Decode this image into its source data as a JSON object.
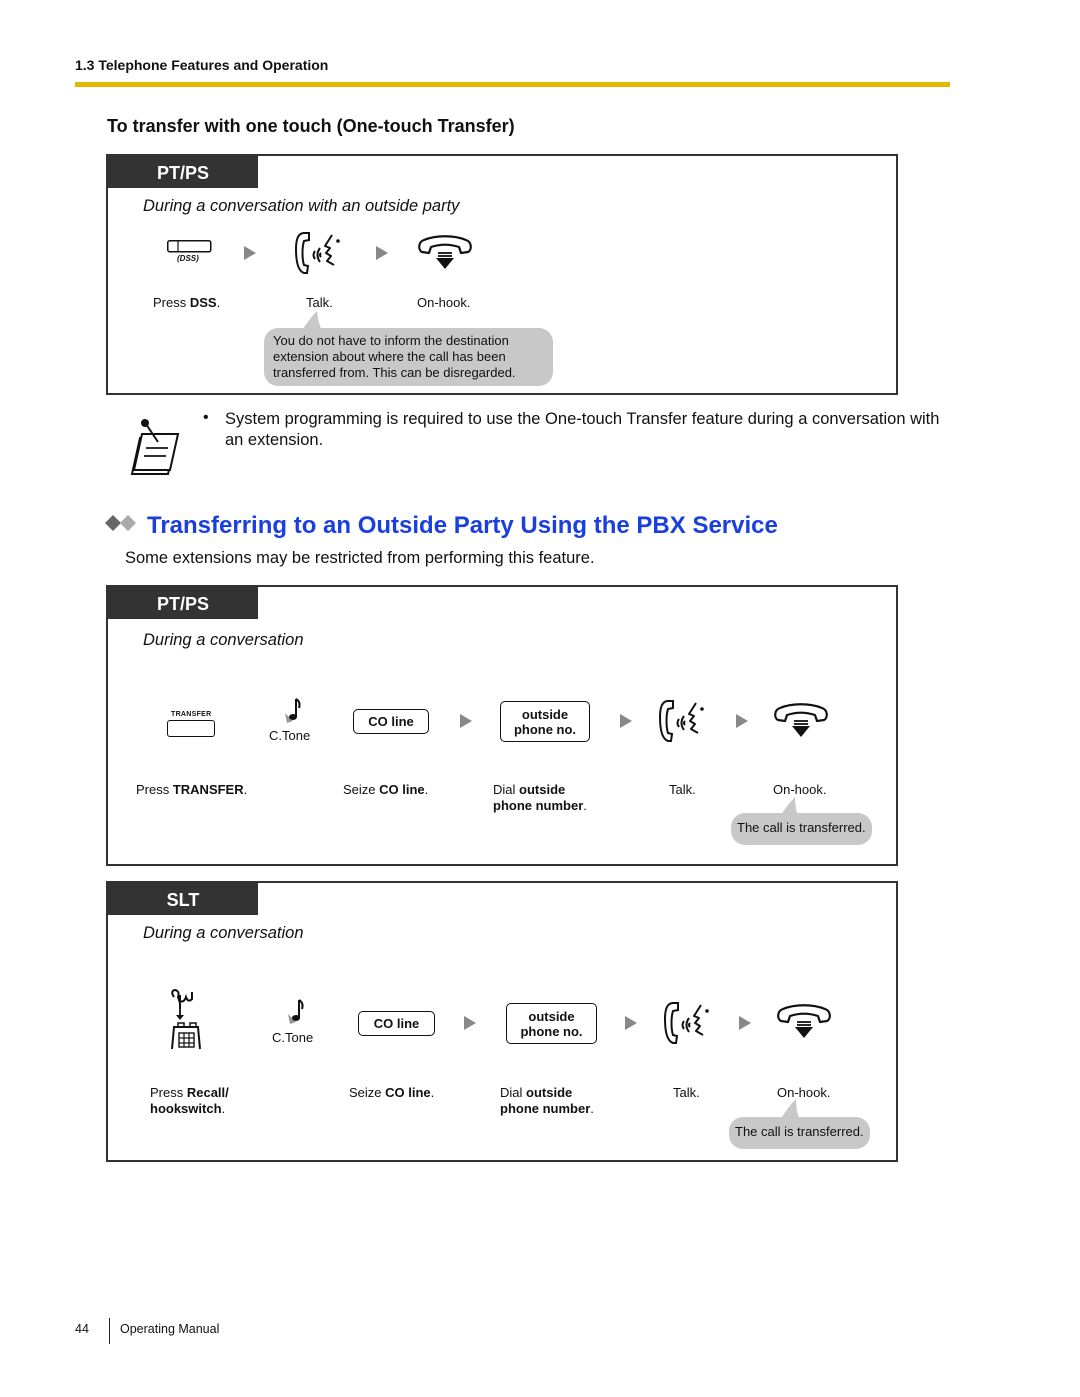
{
  "header": {
    "running_head": "1.3 Telephone Features and Operation",
    "accent_color": "#e3b800"
  },
  "one_touch": {
    "subheading": "To transfer with one touch (One-touch Transfer)",
    "box": {
      "tag": "PT/PS",
      "situation": "During a conversation with an outside party",
      "dss_key_label": "(DSS)",
      "steps": [
        {
          "prefix": "Press ",
          "bold": "DSS",
          "suffix": "."
        },
        {
          "prefix": "Talk.",
          "bold": "",
          "suffix": ""
        },
        {
          "prefix": "On-hook.",
          "bold": "",
          "suffix": ""
        }
      ],
      "bubble": "You do not have to inform the destination extension about where the call has been transferred from. This can be disregarded."
    },
    "note": "System programming is required to use the One-touch Transfer feature during a conversation with an extension.",
    "note_bullet": "•"
  },
  "pbx_section": {
    "title": "Transferring to an Outside Party Using the PBX Service",
    "title_color": "#1a3fe0",
    "intro": "Some extensions may be restricted from performing this feature.",
    "pt_box": {
      "tag": "PT/PS",
      "situation": "During a conversation",
      "transfer_key_label": "TRANSFER",
      "ctone_label": "C.Tone",
      "co_line_key": "CO line",
      "outside_key_line1": "outside",
      "outside_key_line2": "phone no.",
      "steps": {
        "press_prefix": "Press ",
        "press_bold": "TRANSFER",
        "press_suffix": ".",
        "seize_prefix": "Seize ",
        "seize_bold": "CO line",
        "seize_suffix": ".",
        "dial_prefix": "Dial ",
        "dial_bold1": "outside",
        "dial_bold2": "phone number",
        "dial_suffix": ".",
        "talk": "Talk.",
        "onhook": "On-hook."
      },
      "bubble": "The call is transferred."
    },
    "slt_box": {
      "tag": "SLT",
      "situation": "During a conversation",
      "ctone_label": "C.Tone",
      "co_line_key": "CO line",
      "outside_key_line1": "outside",
      "outside_key_line2": "phone no.",
      "steps": {
        "press_prefix": "Press ",
        "press_bold1": "Recall/",
        "press_bold2": "hookswitch",
        "press_suffix": ".",
        "seize_prefix": "Seize ",
        "seize_bold": "CO line",
        "seize_suffix": ".",
        "dial_prefix": "Dial ",
        "dial_bold1": "outside",
        "dial_bold2": "phone number",
        "dial_suffix": ".",
        "talk": "Talk.",
        "onhook": "On-hook."
      },
      "bubble": "The call is transferred."
    }
  },
  "footer": {
    "page_number": "44",
    "manual_title": "Operating Manual"
  }
}
